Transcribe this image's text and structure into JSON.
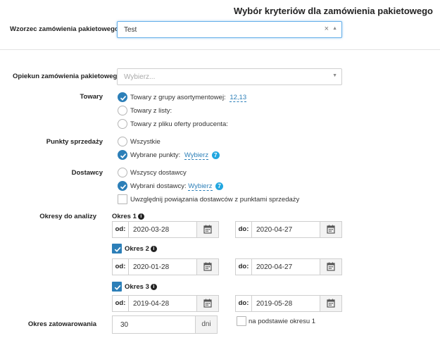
{
  "page_title": "Wybór kryteriów dla zamówienia pakietowego",
  "wzorzec": {
    "label": "Wzorzec zamówienia pakietowego",
    "value": "Test",
    "clear": "×",
    "caret": "▲"
  },
  "opiekun": {
    "label": "Opiekun zamówienia pakietowego",
    "placeholder": "Wybierz...",
    "caret": "▼"
  },
  "towary": {
    "label": "Towary",
    "options": [
      {
        "label": "Towary z grupy asortymentowej:",
        "link": "12,13",
        "checked": true
      },
      {
        "label": "Towary z listy:",
        "checked": false
      },
      {
        "label": "Towary z pliku oferty producenta:",
        "checked": false
      }
    ]
  },
  "punkty": {
    "label": "Punkty sprzedaży",
    "options": [
      {
        "label": "Wszystkie",
        "checked": false
      },
      {
        "label": "Wybrane punkty:",
        "link": "Wybierz",
        "badge": "7",
        "checked": true
      }
    ]
  },
  "dostawcy": {
    "label": "Dostawcy",
    "options": [
      {
        "label": "Wszyscy dostawcy",
        "checked": false
      },
      {
        "label": "Wybrani dostawcy:",
        "link": "Wybierz",
        "badge": "7",
        "checked": true
      }
    ],
    "extra_checkbox": {
      "label": "Uwzględnij powiązania dostawców z punktami sprzedaży",
      "checked": false
    }
  },
  "okresy": {
    "label": "Okresy do analizy",
    "periods": [
      {
        "title": "Okres 1",
        "enabled": null,
        "od_label": "od:",
        "od": "2020-03-28",
        "do_label": "do:",
        "do": "2020-04-27"
      },
      {
        "title": "Okres 2",
        "enabled": true,
        "od_label": "od:",
        "od": "2020-01-28",
        "do_label": "do:",
        "do": "2020-04-27"
      },
      {
        "title": "Okres 3",
        "enabled": true,
        "od_label": "od:",
        "od": "2019-04-28",
        "do_label": "do:",
        "do": "2019-05-28"
      }
    ]
  },
  "zatowarowanie": {
    "label": "Okres zatowarowania",
    "value": "30",
    "unit": "dni",
    "checkbox_label": "na podstawie okresu 1",
    "checked": false
  },
  "colors": {
    "accent": "#2c7fb8",
    "help_badge": "#22a7e0"
  }
}
